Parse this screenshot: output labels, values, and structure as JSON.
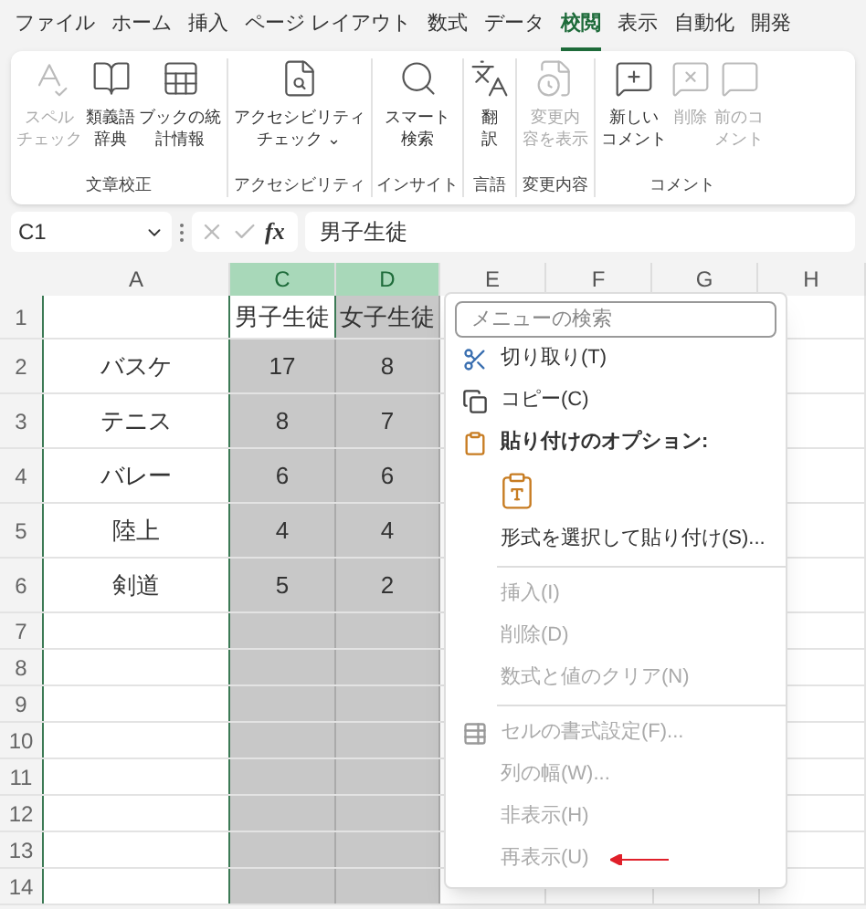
{
  "menu_tabs": [
    {
      "label": "ファイル",
      "selected": false
    },
    {
      "label": "ホーム",
      "selected": false
    },
    {
      "label": "挿入",
      "selected": false
    },
    {
      "label": "ページ レイアウト",
      "selected": false
    },
    {
      "label": "数式",
      "selected": false
    },
    {
      "label": "データ",
      "selected": false
    },
    {
      "label": "校閲",
      "selected": true
    },
    {
      "label": "表示",
      "selected": false
    },
    {
      "label": "自動化",
      "selected": false
    },
    {
      "label": "開発",
      "selected": false
    }
  ],
  "ribbon_groups": [
    {
      "label": "文章校正",
      "buttons": [
        {
          "lines": [
            "スペル",
            "チェック"
          ],
          "disabled": true
        },
        {
          "lines": [
            "類義語",
            "辞典"
          ],
          "disabled": false
        },
        {
          "lines": [
            "ブックの統",
            "計情報"
          ],
          "disabled": false
        }
      ]
    },
    {
      "label": "アクセシビリティ",
      "buttons": [
        {
          "lines": [
            "アクセシビリティ",
            "チェック ⌄"
          ],
          "disabled": false
        }
      ]
    },
    {
      "label": "インサイト",
      "buttons": [
        {
          "lines": [
            "スマート",
            "検索"
          ],
          "disabled": false
        }
      ]
    },
    {
      "label": "言語",
      "buttons": [
        {
          "lines": [
            "翻",
            "訳"
          ],
          "disabled": false
        }
      ]
    },
    {
      "label": "変更内容",
      "buttons": [
        {
          "lines": [
            "変更内",
            "容を表示"
          ],
          "disabled": true
        }
      ]
    },
    {
      "label": "コメント",
      "buttons": [
        {
          "lines": [
            "新しい",
            "コメント"
          ],
          "disabled": false
        },
        {
          "lines": [
            "削除"
          ],
          "disabled": true
        },
        {
          "lines": [
            "前のコ",
            "メント"
          ],
          "disabled": true
        }
      ]
    }
  ],
  "formula_bar": {
    "name_box": "C1",
    "fx": "fx",
    "value": "男子生徒"
  },
  "columns": [
    {
      "label": "A",
      "selected": false
    },
    {
      "label": "C",
      "selected": true
    },
    {
      "label": "D",
      "selected": true
    },
    {
      "label": "E",
      "selected": false
    },
    {
      "label": "F",
      "selected": false
    },
    {
      "label": "G",
      "selected": false
    },
    {
      "label": "H",
      "selected": false
    }
  ],
  "rows": [
    {
      "number": "1",
      "c": {
        "text": "男子生徒",
        "active": true
      },
      "d": {
        "text": "女子生徒",
        "active": false
      }
    },
    {
      "number": "2",
      "a": "バスケ",
      "c": {
        "text": "17",
        "active": false
      },
      "d": {
        "text": "8",
        "active": false
      }
    },
    {
      "number": "3",
      "a": "テニス",
      "c": {
        "text": "8",
        "active": false
      },
      "d": {
        "text": "7",
        "active": false
      }
    },
    {
      "number": "4",
      "a": "バレー",
      "c": {
        "text": "6",
        "active": false
      },
      "d": {
        "text": "6",
        "active": false
      }
    },
    {
      "number": "5",
      "a": "陸上",
      "c": {
        "text": "4",
        "active": false
      },
      "d": {
        "text": "4",
        "active": false
      }
    },
    {
      "number": "6",
      "a": "剣道",
      "c": {
        "text": "5",
        "active": false
      },
      "d": {
        "text": "2",
        "active": false
      }
    },
    {
      "number": "7"
    },
    {
      "number": "8"
    },
    {
      "number": "9"
    },
    {
      "number": "10"
    },
    {
      "number": "11"
    },
    {
      "number": "12"
    },
    {
      "number": "13"
    },
    {
      "number": "14"
    }
  ],
  "context_menu": {
    "search": {
      "placeholder": "メニューの検索"
    },
    "items": [
      {
        "kind": "item",
        "label": "切り取り(T)",
        "disabled": false
      },
      {
        "kind": "item",
        "label": "コピー(C)",
        "disabled": false
      },
      {
        "kind": "header",
        "label": "貼り付けのオプション:",
        "disabled": false
      },
      {
        "kind": "paste"
      },
      {
        "kind": "item",
        "label": "形式を選択して貼り付け(S)...",
        "disabled": false
      },
      {
        "kind": "separator"
      },
      {
        "kind": "item",
        "label": "挿入(I)",
        "disabled": true
      },
      {
        "kind": "item",
        "label": "削除(D)",
        "disabled": true
      },
      {
        "kind": "item",
        "label": "数式と値のクリア(N)",
        "disabled": true
      },
      {
        "kind": "separator"
      },
      {
        "kind": "item",
        "label": "セルの書式設定(F)...",
        "disabled": true
      },
      {
        "kind": "item",
        "label": "列の幅(W)...",
        "disabled": true
      },
      {
        "kind": "item",
        "label": "非表示(H)",
        "disabled": true
      },
      {
        "kind": "item",
        "label": "再表示(U)",
        "disabled": true,
        "pointer": true
      }
    ]
  }
}
